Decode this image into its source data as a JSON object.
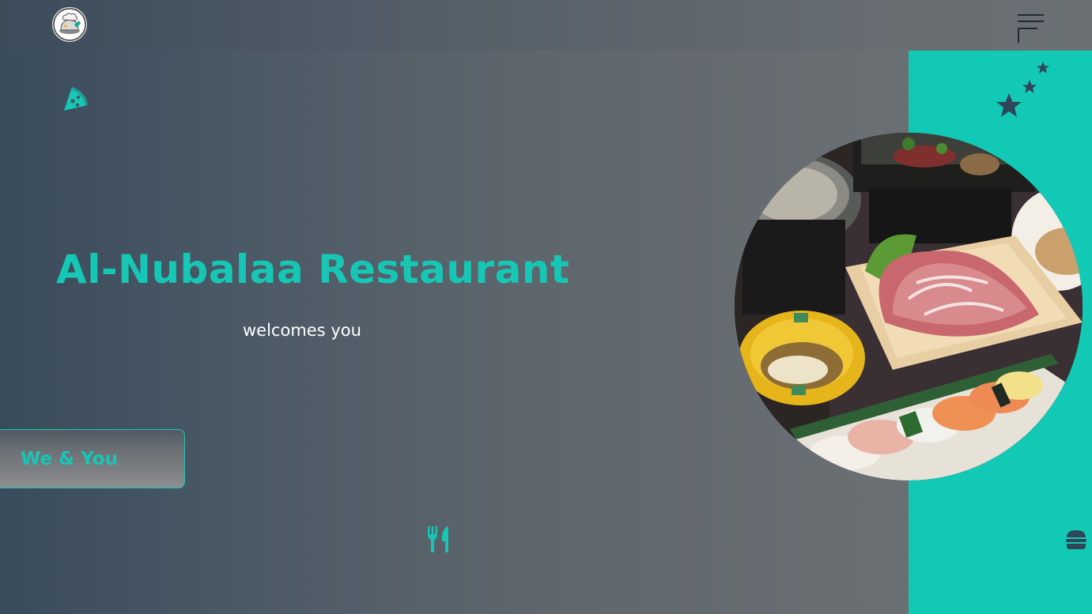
{
  "header": {
    "logo_icon": "chef-hat-logo-icon",
    "menu_icon": "hamburger-menu-icon"
  },
  "hero": {
    "title": "Al-Nubalaa Restaurant",
    "subtitle": "welcomes you",
    "cta_label": "We & You"
  },
  "decorations": {
    "top_left_icon": "pizza-slice-icon",
    "bottom_icon": "fork-knife-icon",
    "right_icon": "burger-icon",
    "stars_icon": "stars-icon",
    "image": "japanese-food-platter-image"
  },
  "colors": {
    "accent": "#12c9b6",
    "text_light": "#ffffff",
    "dark_icon": "#2f4558"
  }
}
